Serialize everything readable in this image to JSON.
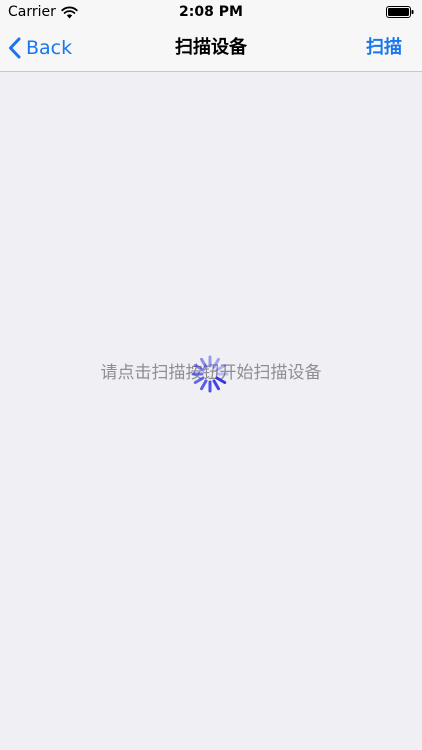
{
  "status_bar": {
    "carrier": "Carrier",
    "time": "2:08 PM",
    "icons": [
      "wifi-icon",
      "battery-icon"
    ]
  },
  "nav": {
    "back_label": "Back",
    "title": "扫描设备",
    "scan_label": "扫描",
    "back_icon": "chevron-left-icon"
  },
  "content": {
    "hint": "请点击扫描按钮开始扫描设备",
    "loading_icon": "activity-spinner-icon"
  },
  "colors": {
    "accent": "#1976ee",
    "background": "#efeff4",
    "bar_background": "#f7f7f7",
    "hint_text": "#8e8e93",
    "spinner": "#2b2be6"
  }
}
